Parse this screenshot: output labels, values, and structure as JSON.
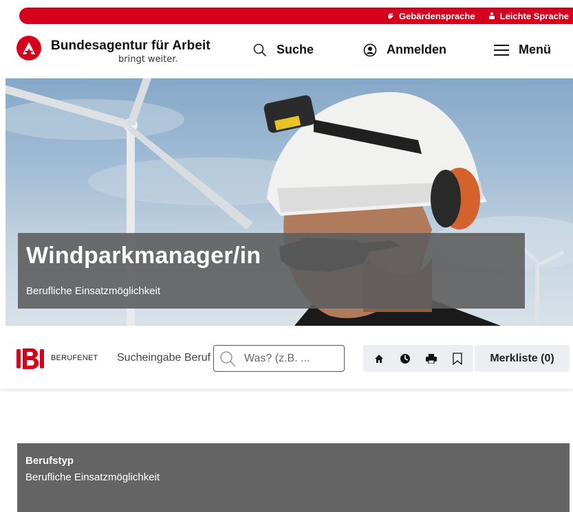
{
  "topbar": {
    "sign_language": "Gebärdensprache",
    "easy_language": "Leichte Sprache",
    "accent": "#d6001c"
  },
  "header": {
    "brand_name": "Bundesagentur für Arbeit",
    "brand_slogan": "bringt weiter.",
    "search_label": "Suche",
    "login_label": "Anmelden",
    "menu_label": "Menü"
  },
  "hero": {
    "title": "Windparkmanager/in",
    "subtitle": "Berufliche Einsatzmöglichkeit"
  },
  "toolbar": {
    "berufenet_label": "BERUFENET",
    "search_label": "Sucheingabe Beruf",
    "search_placeholder": "Was? (z.B. ...",
    "icons": [
      "home-icon",
      "clock-icon",
      "print-icon",
      "bookmark-icon"
    ],
    "merkliste_label": "Merkliste (0)"
  },
  "berufstyp": {
    "heading": "Berufstyp",
    "value": "Berufliche Einsatzmöglichkeit"
  }
}
